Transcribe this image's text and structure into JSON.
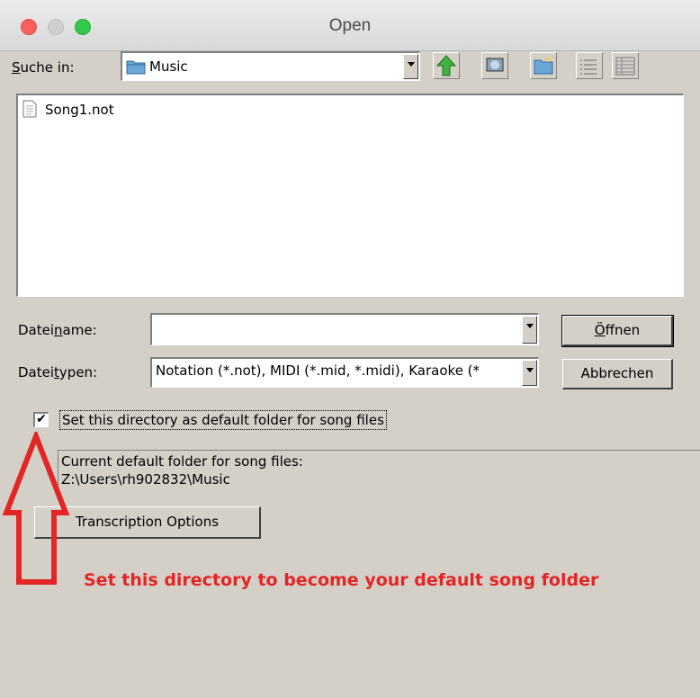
{
  "window": {
    "title": "Open"
  },
  "toolbar": {
    "look_in_label_pre": "",
    "look_in_label_ul": "S",
    "look_in_label_post": "uche in:",
    "look_in_value": "Music",
    "buttons": [
      "up-folder-icon",
      "desktop-icon",
      "new-folder-icon",
      "list-view-icon",
      "details-view-icon"
    ]
  },
  "files": [
    {
      "name": "Song1.not",
      "icon": "document-icon"
    }
  ],
  "filename": {
    "label_pre": "Datei",
    "label_ul": "n",
    "label_post": "ame:",
    "value": ""
  },
  "filetype": {
    "label_pre": "Datei",
    "label_ul": "t",
    "label_post": "ypen:",
    "value": "Notation (*.not), MIDI (*.mid, *.midi), Karaoke (*"
  },
  "buttons": {
    "open_ul": "Ö",
    "open_rest": "ffnen",
    "cancel": "Abbrechen",
    "transcription": "Transcription Options"
  },
  "default_folder": {
    "checkbox_checked": true,
    "checkbox_label": "Set this directory as default folder for song files",
    "current_label": "Current default folder for song files:",
    "current_path": "Z:\\Users\\rh902832\\Music"
  },
  "annotation": {
    "text": "Set this directory to become  your default song folder",
    "color": "#e32525"
  }
}
